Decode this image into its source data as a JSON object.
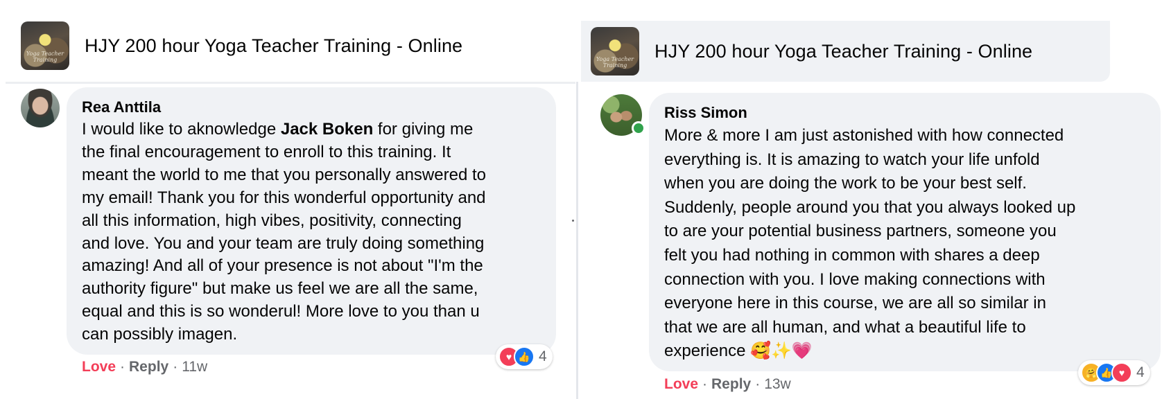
{
  "left_post": {
    "group_title": "HJY 200 hour Yoga Teacher Training - Online",
    "thumb_caption": "Yoga Teacher Training",
    "author": "Rea Anttila",
    "lines": [
      {
        "pre": "I would like to aknowledge ",
        "bold": "Jack Boken",
        "post": " for giving me"
      },
      {
        "text": "the final encouragement to enroll to this training. It"
      },
      {
        "text": "meant the world to me that you personally answered to"
      },
      {
        "text": "my email! Thank you for this wonderful opportunity and"
      },
      {
        "text": "all this information, high vibes, positivity, connecting"
      },
      {
        "text": "and love. You and your team are truly doing something"
      },
      {
        "text": "amazing! And all of your presence is not about \"I'm the"
      },
      {
        "text": "authority figure\" but make us feel we are all the same,"
      },
      {
        "text": "equal and this is so wonderul! More love to you than u"
      },
      {
        "text": "can possibly imagen."
      }
    ],
    "love_label": "Love",
    "reply_label": "Reply",
    "age": "11w",
    "reaction_count": "4",
    "reactions": [
      "love-icon",
      "like-icon"
    ]
  },
  "right_post": {
    "group_title": "HJY 200 hour Yoga Teacher Training - Online",
    "thumb_caption": "Yoga Teacher Training",
    "author": "Riss Simon",
    "lines": [
      {
        "text": "More & more I am just astonished with how connected"
      },
      {
        "text": "everything is. It is amazing to watch your life unfold"
      },
      {
        "text": "when you are doing the work to be your best self."
      },
      {
        "text": "Suddenly, people around you that you always looked up"
      },
      {
        "text": "to are your potential business partners, someone you"
      },
      {
        "text": "felt you had nothing in common with shares a deep"
      },
      {
        "text": "connection with you. I love making connections with"
      },
      {
        "text": "everyone here in this course, we are all so similar in"
      },
      {
        "text": "that we are all human, and what a beautiful life to"
      },
      {
        "text": "experience 🥰✨💗"
      }
    ],
    "love_label": "Love",
    "reply_label": "Reply",
    "age": "13w",
    "reaction_count": "4",
    "reactions": [
      "care-icon",
      "like-icon",
      "love-icon"
    ]
  },
  "colors": {
    "love": "#f33e58",
    "like": "#1877f2",
    "online": "#31a24c",
    "bubble": "#f0f2f5",
    "meta": "#65676b"
  },
  "icons": {
    "love-icon": "♥",
    "like-icon": "👍",
    "care-icon": "🤗"
  }
}
